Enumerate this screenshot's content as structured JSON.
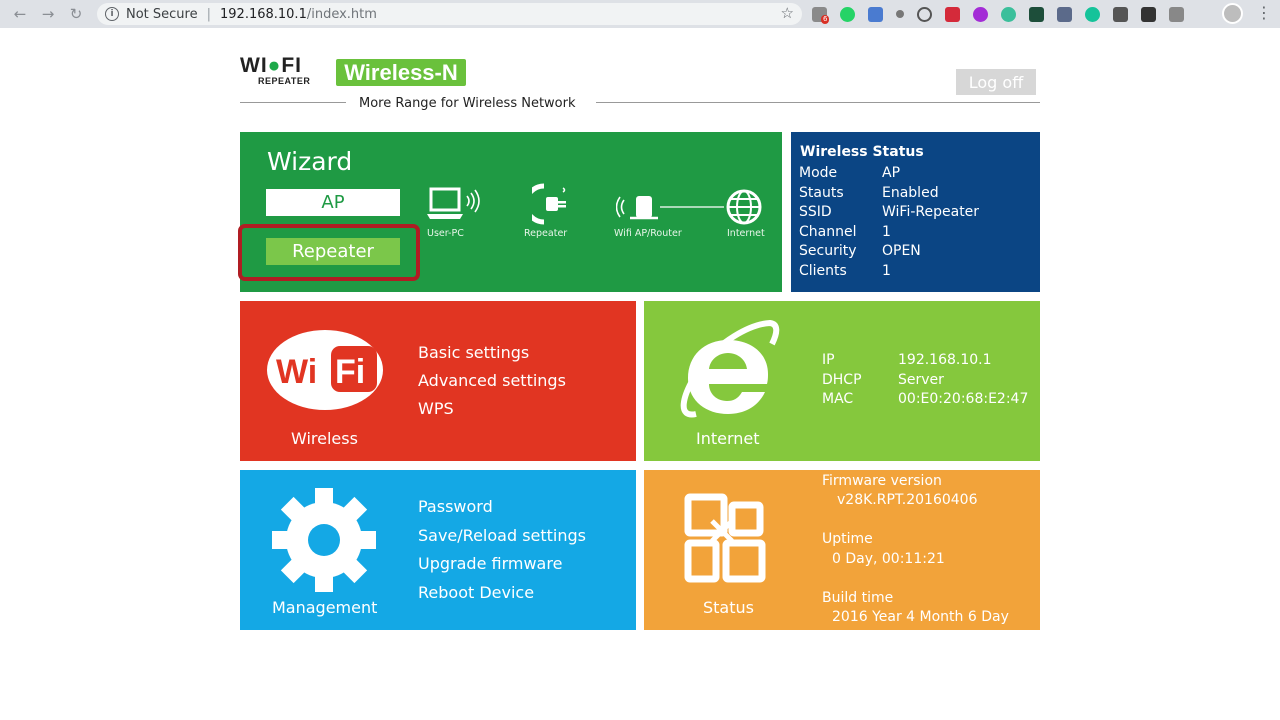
{
  "browser": {
    "security": "Not Secure",
    "url_host": "192.168.10.1",
    "url_path": "/index.htm",
    "mail_badge": "6"
  },
  "header": {
    "logo_wifi_left": "WI",
    "logo_wifi_right": "FI",
    "logo_repeater": "REPEATER",
    "brand": "Wireless-N",
    "tagline": "More Range for Wireless Network",
    "logoff": "Log off"
  },
  "wizard": {
    "title": "Wizard",
    "ap_label": "AP",
    "repeater_label": "Repeater",
    "steps": [
      "User-PC",
      "Repeater",
      "Wifi AP/Router",
      "Internet"
    ]
  },
  "wireless_status": {
    "title": "Wireless Status",
    "rows": [
      {
        "key": "Mode",
        "value": "AP"
      },
      {
        "key": "Stauts",
        "value": "Enabled"
      },
      {
        "key": "SSID",
        "value": "WiFi-Repeater"
      },
      {
        "key": "Channel",
        "value": "1"
      },
      {
        "key": "Security",
        "value": "OPEN"
      },
      {
        "key": "Clients",
        "value": "1"
      }
    ]
  },
  "wireless": {
    "label": "Wireless",
    "logo_wi": "Wi",
    "logo_fi": "Fi",
    "items": [
      "Basic settings",
      "Advanced settings",
      "WPS"
    ]
  },
  "internet": {
    "label": "Internet",
    "rows": [
      {
        "key": "IP",
        "value": "192.168.10.1"
      },
      {
        "key": "DHCP",
        "value": "Server"
      },
      {
        "key": "MAC",
        "value": "00:E0:20:68:E2:47"
      }
    ]
  },
  "management": {
    "label": "Management",
    "items": [
      "Password",
      "Save/Reload settings",
      "Upgrade firmware",
      "Reboot Device"
    ]
  },
  "status": {
    "label": "Status",
    "firmware_title": "Firmware version",
    "firmware_value": "v28K.RPT.20160406",
    "uptime_title": "Uptime",
    "uptime_value": "0 Day, 00:11:21",
    "build_title": "Build time",
    "build_value": "2016 Year 4 Month 6 Day"
  },
  "colors": {
    "wizard": "#1f9a44",
    "wireless_status": "#0b4584",
    "wireless": "#e13522",
    "internet": "#85c83d",
    "management": "#14a8e5",
    "status": "#f2a33a",
    "highlight": "#b01d23"
  }
}
